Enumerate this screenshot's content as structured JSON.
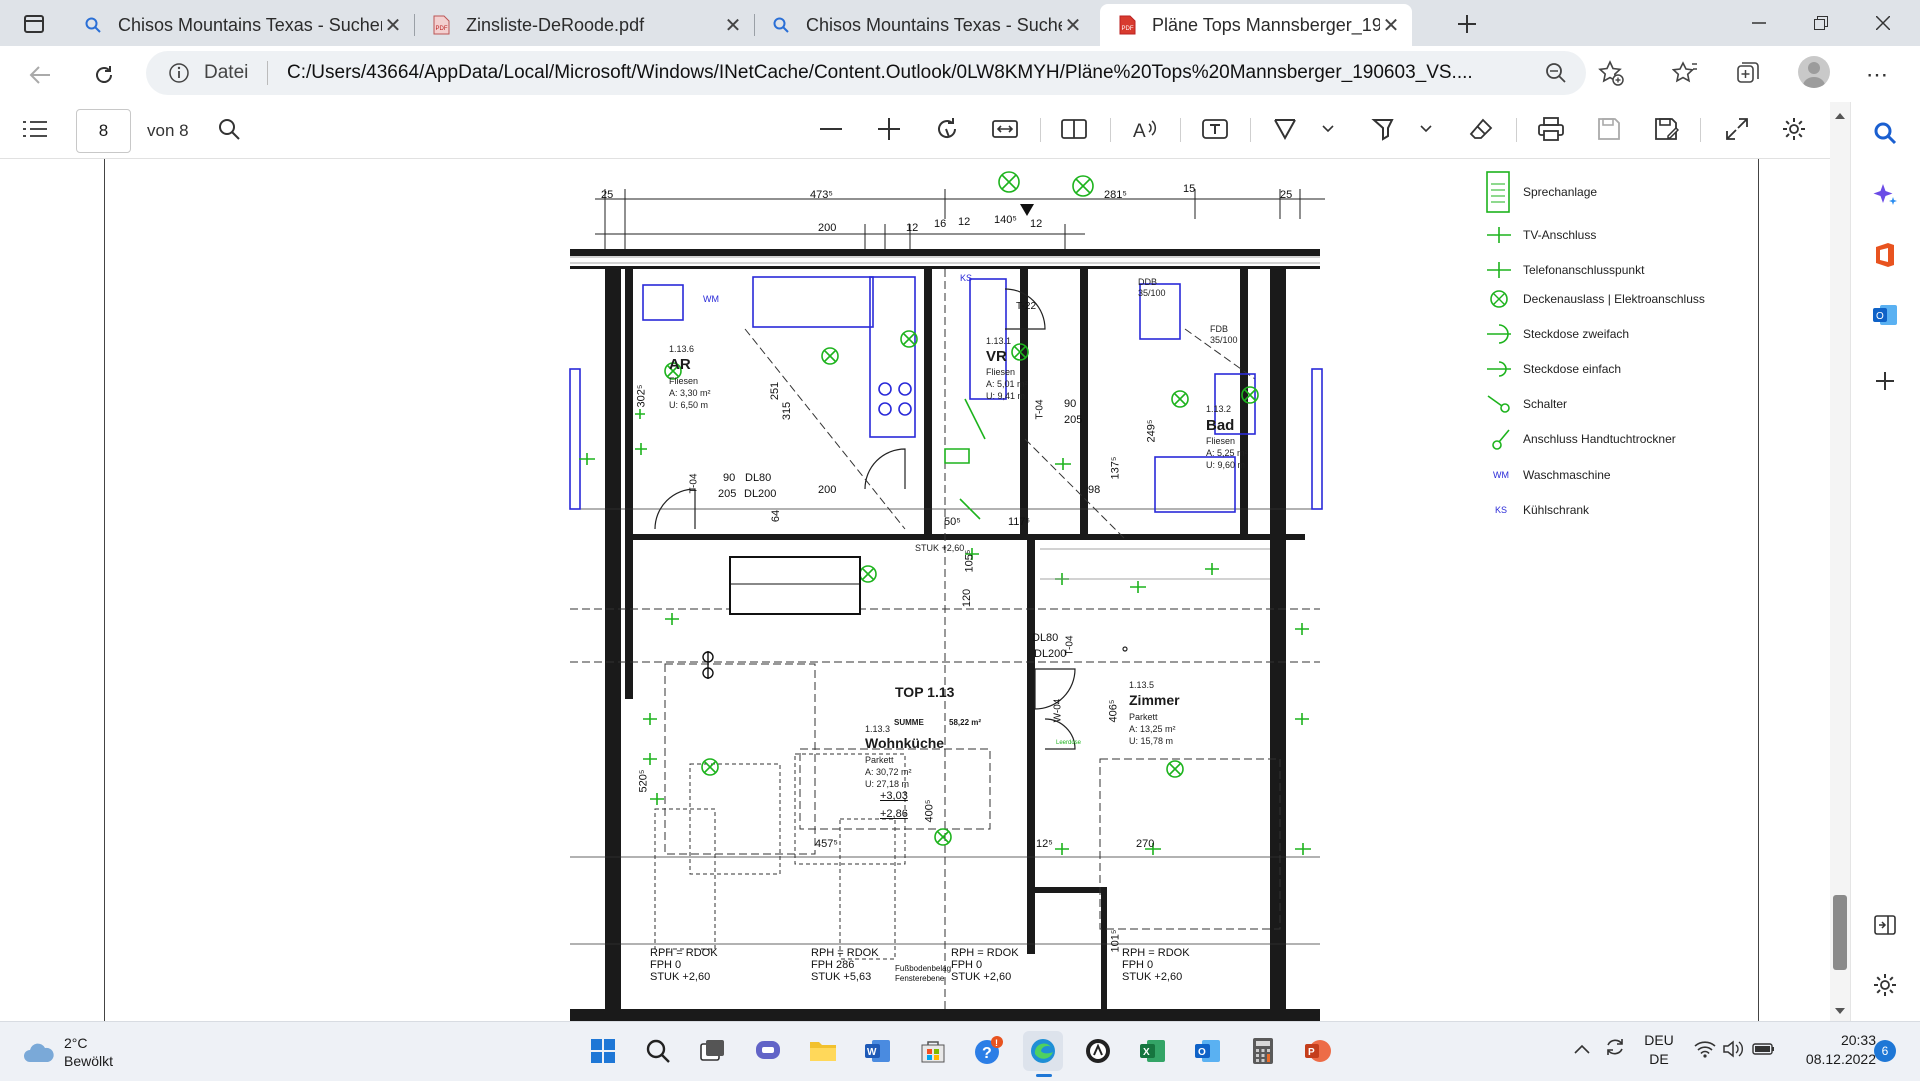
{
  "browser": {
    "tabs": [
      {
        "label": "Chisos Mountains Texas - Suchen",
        "icon": "search-icon"
      },
      {
        "label": "Zinsliste-DeRoode.pdf",
        "icon": "pdf-icon"
      },
      {
        "label": "Chisos Mountains Texas - Suchen",
        "icon": "search-icon"
      },
      {
        "label": "Pläne Tops Mannsberger_190603",
        "icon": "pdf-icon"
      }
    ],
    "address": {
      "scheme_label": "Datei",
      "url": "C:/Users/43664/AppData/Local/Microsoft/Windows/INetCache/Content.Outlook/0LW8KMYH/Pläne%20Tops%20Mannsberger_190603_VS...."
    }
  },
  "pdf_toolbar": {
    "page_number": "8",
    "page_of": "von 8"
  },
  "plan": {
    "top_dims": [
      "25",
      "473⁵",
      "281⁵",
      "15",
      "25",
      "200",
      "12",
      "16",
      "12",
      "140⁵",
      "12"
    ],
    "rooms": [
      {
        "name": "AR",
        "code": "1.13.6",
        "floor": "Fliesen",
        "area": "A: 3,30 m²",
        "perimeter": "U: 6,50 m"
      },
      {
        "name": "VR",
        "code": "1.13.1",
        "floor": "Fliesen",
        "area": "A: 5,01 m²",
        "perimeter": "U: 9,41 m"
      },
      {
        "name": "Bad",
        "code": "1.13.2",
        "floor": "Fliesen",
        "area": "A: 5,25 m²",
        "perimeter": "U: 9,60 m"
      },
      {
        "name": "Wohnküche",
        "code": "1.13.3",
        "floor": "Parkett",
        "area": "A: 30,72 m²",
        "perimeter": "U: 27,18 m"
      },
      {
        "name": "Zimmer",
        "code": "1.13.5",
        "floor": "Parkett",
        "area": "A: 13,25 m²",
        "perimeter": "U: 15,78 m"
      }
    ],
    "top_box": {
      "title": "TOP 1.13",
      "sum_label": "SUMME",
      "sum_value": "58,22 m²"
    },
    "heights": [
      "+3,03",
      "+2,86"
    ],
    "door_tags": [
      "T-04",
      "T-22",
      "T-04",
      "T-04",
      "W-04"
    ],
    "door_dims": [
      "90",
      "DL80",
      "205",
      "DL200",
      "90",
      "DL80",
      "205",
      "DL200"
    ],
    "misc_dims": [
      "200",
      "117⁵",
      "50⁵",
      "98",
      "457⁵",
      "270",
      "12⁵",
      "400⁵",
      "406⁵",
      "520⁵",
      "251",
      "315",
      "302⁵",
      "249⁵",
      "137⁵",
      "105⁵",
      "120",
      "101⁵",
      "64"
    ],
    "bottom_notes": [
      [
        "RPH = RDOK",
        "FPH 0",
        "STUK +2,60"
      ],
      [
        "RPH = RDOK",
        "FPH 286",
        "STUK +5,63"
      ],
      [
        "RPH = RDOK",
        "FPH 0",
        "STUK +2,60"
      ],
      [
        "RPH = RDOK",
        "FPH 0",
        "STUK +2,60"
      ]
    ],
    "floor_note": "Fußbodenbelag Fensterebene",
    "misc_labels": [
      "DDB 35/100",
      "FDB 35/100",
      "STUK +2,60",
      "KS",
      "WM",
      "Leerdose"
    ],
    "legend": [
      {
        "label": "Sprechanlage",
        "icon": "intercom-icon"
      },
      {
        "label": "TV-Anschluss",
        "icon": "tv-outlet-icon"
      },
      {
        "label": "Telefonanschlusspunkt",
        "icon": "phone-outlet-icon"
      },
      {
        "label": "Deckenauslass | Elektroanschluss",
        "icon": "ceiling-outlet-icon"
      },
      {
        "label": "Steckdose zweifach",
        "icon": "double-socket-icon"
      },
      {
        "label": "Steckdose einfach",
        "icon": "single-socket-icon"
      },
      {
        "label": "Schalter",
        "icon": "switch-icon"
      },
      {
        "label": "Anschluss Handtuchtrockner",
        "icon": "towel-dryer-icon"
      },
      {
        "label": "Waschmaschine",
        "icon": "washing-machine-icon",
        "abbr": "WM"
      },
      {
        "label": "Kühlschrank",
        "icon": "fridge-icon",
        "abbr": "KS"
      }
    ]
  },
  "taskbar": {
    "weather": {
      "temp": "2°C",
      "desc": "Bewölkt"
    },
    "lang": {
      "line1": "DEU",
      "line2": "DE"
    },
    "clock": {
      "time": "20:33",
      "date": "08.12.2022"
    },
    "notifications": "6"
  },
  "colors": {
    "accent_green": "#1db31d",
    "accent_blue": "#2a2ad8",
    "tab_strip": "#dfe3e8",
    "taskbar": "#eef1f6"
  }
}
